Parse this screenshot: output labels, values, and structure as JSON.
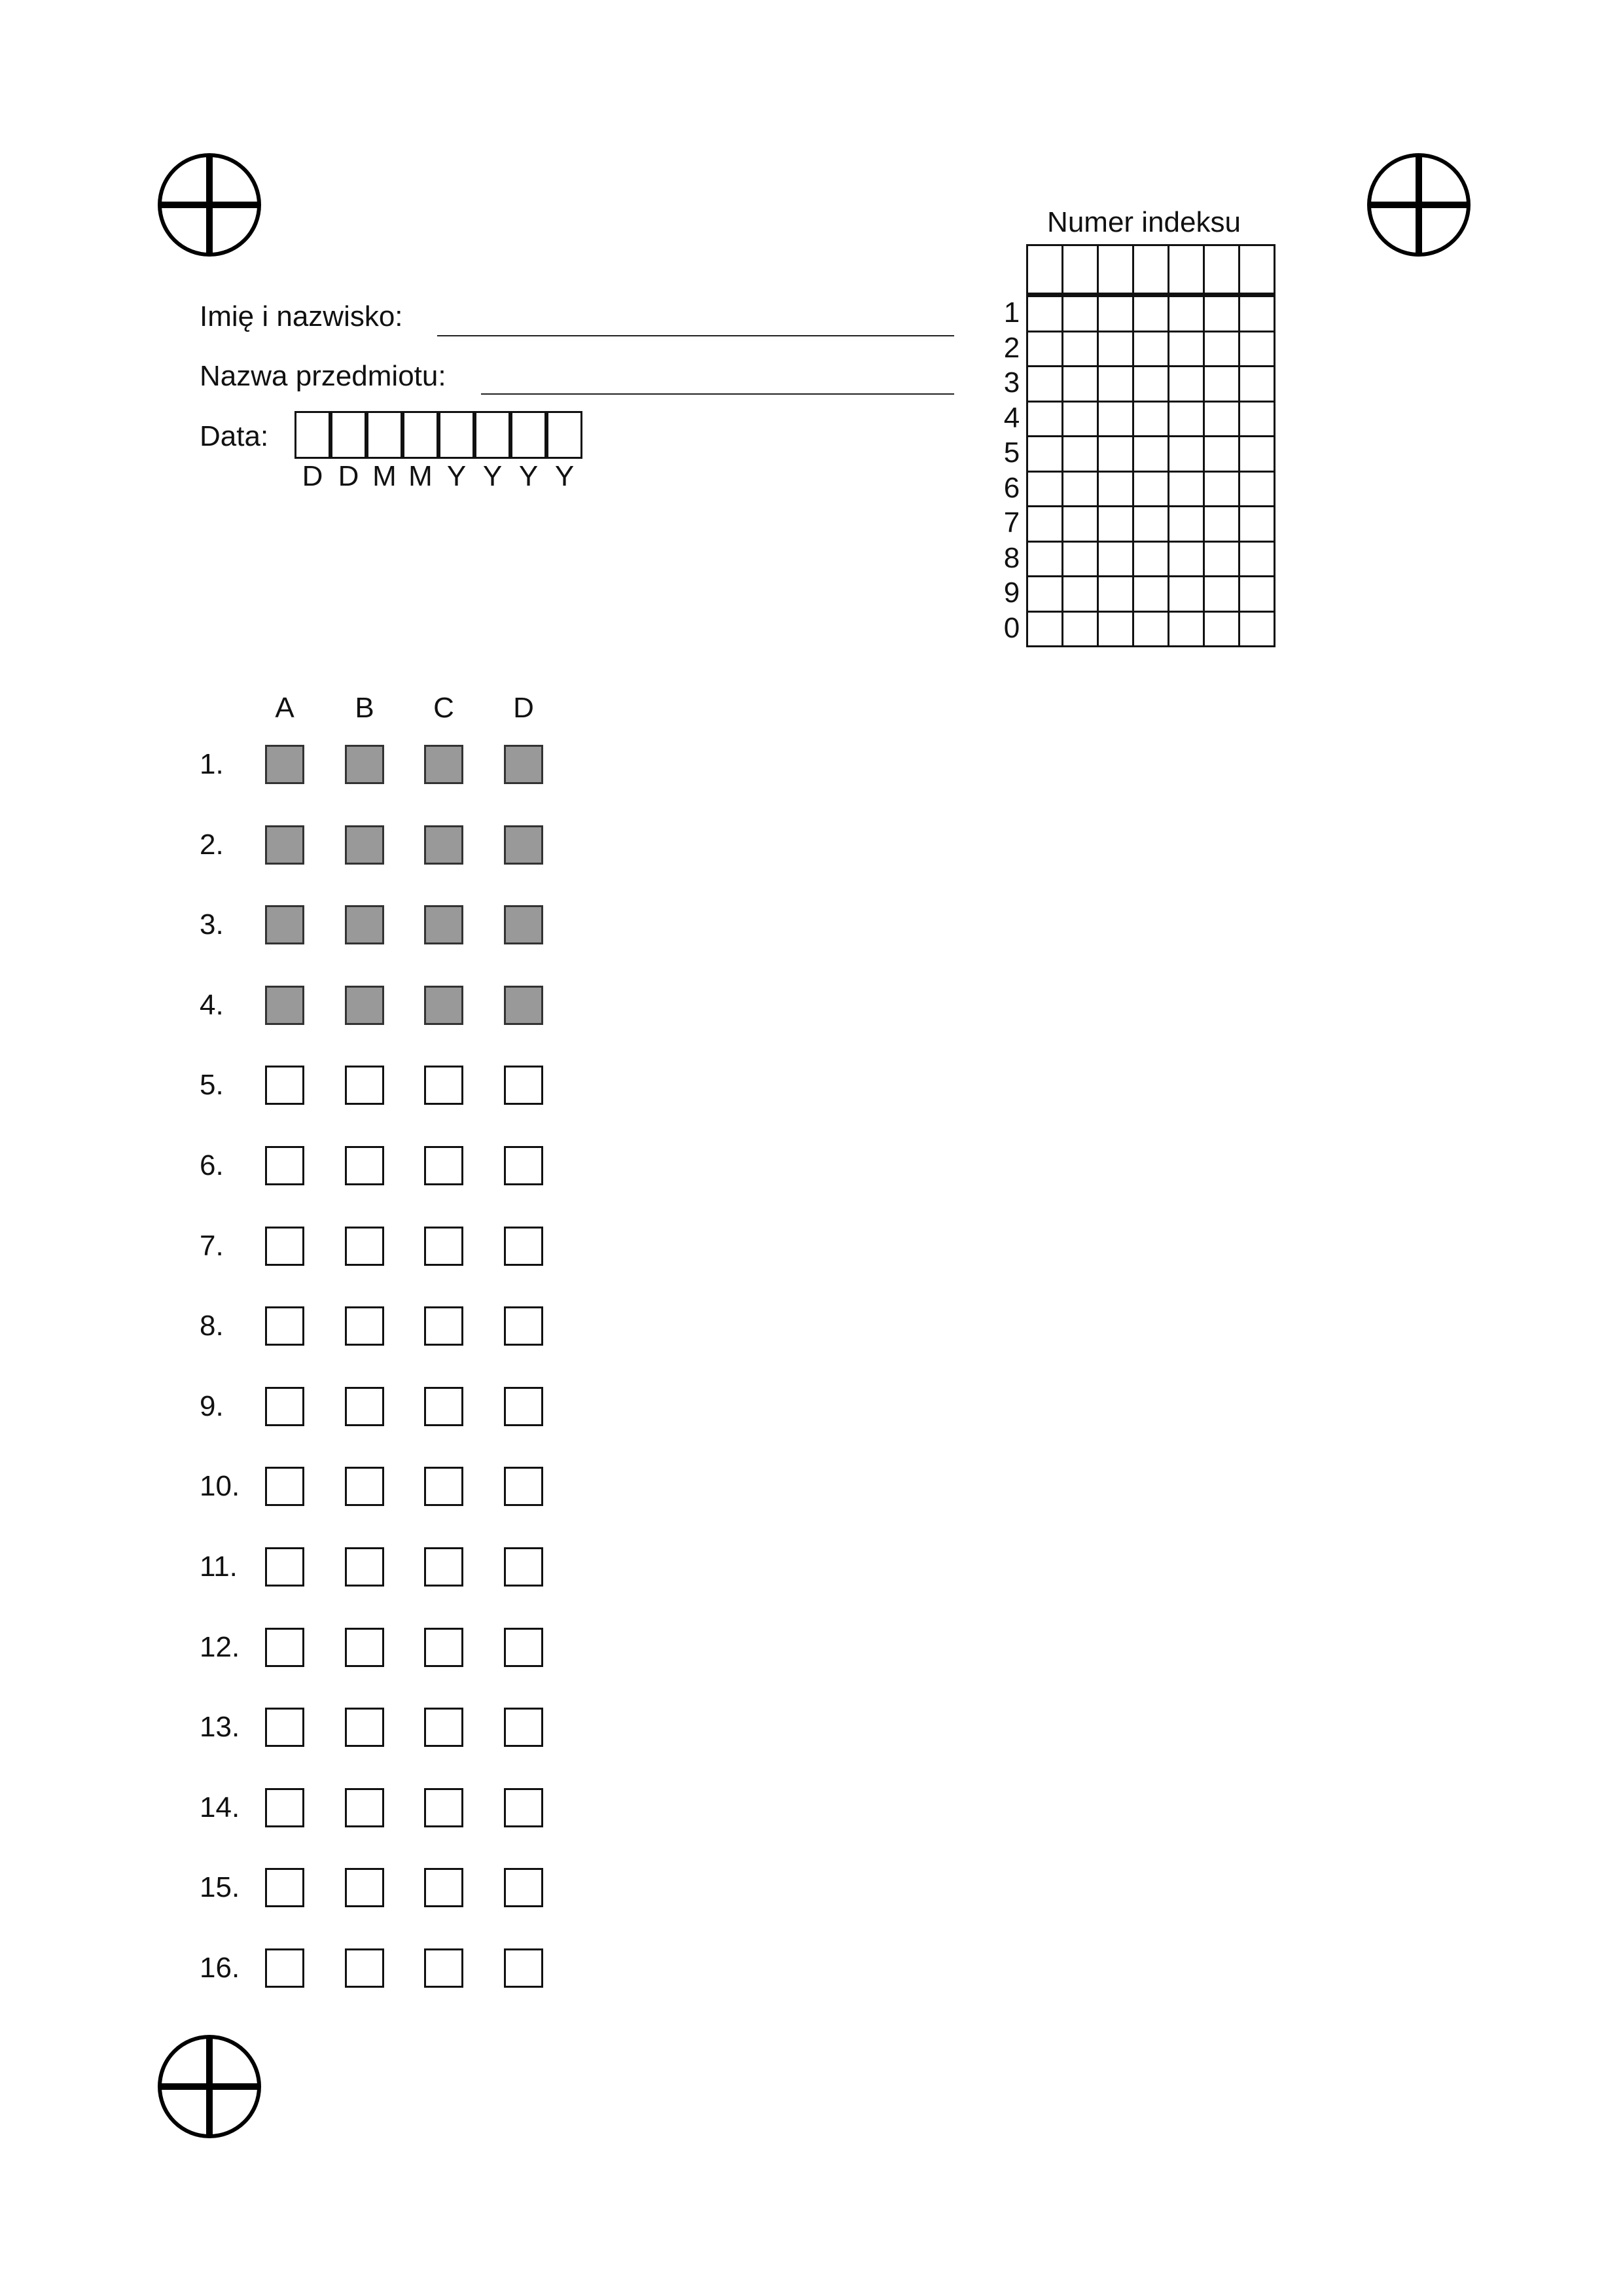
{
  "markers": [
    "registration-mark-top-left",
    "registration-mark-top-right",
    "registration-mark-bottom-left"
  ],
  "header": {
    "name_label": "Imię i nazwisko:",
    "subject_label": "Nazwa przedmiotu:",
    "date_label": "Data:",
    "date_format": [
      "D",
      "D",
      "M",
      "M",
      "Y",
      "Y",
      "Y",
      "Y"
    ]
  },
  "index": {
    "title": "Numer indeksu",
    "columns": 7,
    "digits": [
      "1",
      "2",
      "3",
      "4",
      "5",
      "6",
      "7",
      "8",
      "9",
      "0"
    ]
  },
  "answers": {
    "options": [
      "A",
      "B",
      "C",
      "D"
    ],
    "questions": [
      {
        "label": "1.",
        "shaded": true
      },
      {
        "label": "2.",
        "shaded": true
      },
      {
        "label": "3.",
        "shaded": true
      },
      {
        "label": "4.",
        "shaded": true
      },
      {
        "label": "5.",
        "shaded": false
      },
      {
        "label": "6.",
        "shaded": false
      },
      {
        "label": "7.",
        "shaded": false
      },
      {
        "label": "8.",
        "shaded": false
      },
      {
        "label": "9.",
        "shaded": false
      },
      {
        "label": "10.",
        "shaded": false
      },
      {
        "label": "11.",
        "shaded": false
      },
      {
        "label": "12.",
        "shaded": false
      },
      {
        "label": "13.",
        "shaded": false
      },
      {
        "label": "14.",
        "shaded": false
      },
      {
        "label": "15.",
        "shaded": false
      },
      {
        "label": "16.",
        "shaded": false
      }
    ],
    "shaded_color": "#999999"
  }
}
